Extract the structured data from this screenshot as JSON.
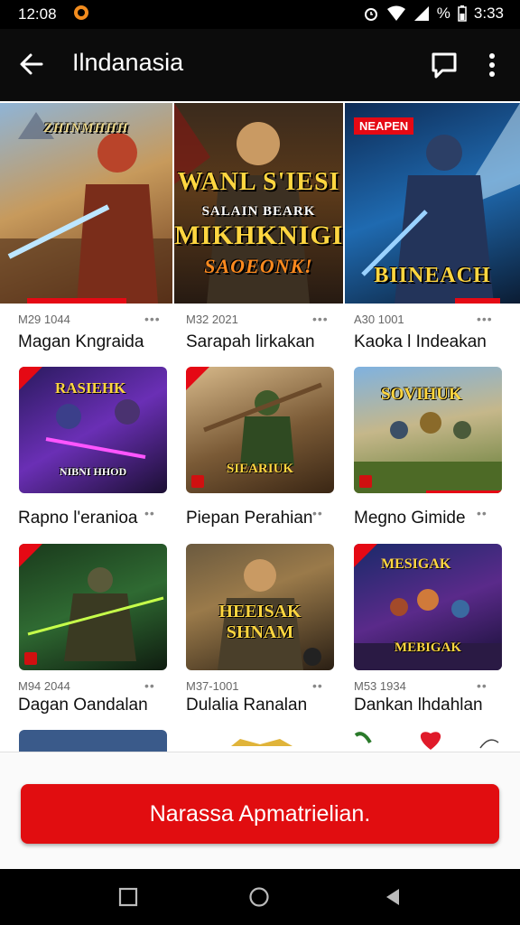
{
  "status_bar": {
    "time": "12:08",
    "battery": "%",
    "clock_right": "3:33"
  },
  "app_bar": {
    "title": "Ilndanasia"
  },
  "hero": [
    {
      "caption_top": "ZHINMHHH",
      "caption_bottom": ""
    },
    {
      "caption_top": "WANL S'IESI",
      "caption_mid": "SALAIN BEARK",
      "caption_main": "MIKHKNIGI",
      "caption_bottom": "SAOEONK!"
    },
    {
      "badge": "NEAPEN",
      "caption_bottom": "BIINEACH"
    }
  ],
  "grid": [
    {
      "meta": "M29 1044",
      "name": "Magan Kngraida"
    },
    {
      "meta": "M32 2021",
      "name": "Sarapah lirkakan"
    },
    {
      "meta": "A30 1001",
      "name": "Kaoka l Indeakan"
    },
    {
      "meta": "",
      "name": "Rapno l'eranioa",
      "thumb_label_top": "RASIEHK",
      "thumb_label": "NIBNI HHOD"
    },
    {
      "meta": "",
      "name": "Piepan Perahian",
      "thumb_label": "SIEARIUK"
    },
    {
      "meta": "",
      "name": "Megno Gimide",
      "thumb_label": "SOVIHUK"
    },
    {
      "meta": "M94 2044",
      "name": "Dagan Oandalan",
      "thumb_label": ""
    },
    {
      "meta": "M37-1001",
      "name": "Dulalia Ranalan",
      "thumb_label": "HEEISAK SHNAM"
    },
    {
      "meta": "M53 1934",
      "name": "Dankan lhdahlan",
      "thumb_label_top": "MESIGAK",
      "thumb_label": "MEBIGAK"
    }
  ],
  "cta": {
    "label": "Narassa Apmatrielian."
  },
  "colors": {
    "accent": "#e10d10",
    "appbar": "#0c0c0c",
    "statusbar": "#000000"
  }
}
